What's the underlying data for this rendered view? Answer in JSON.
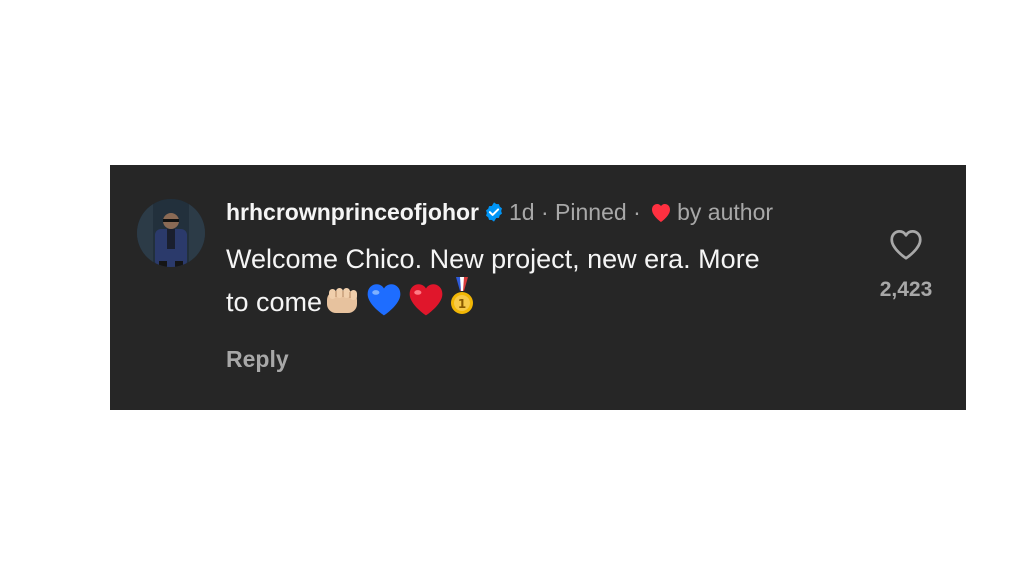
{
  "comment": {
    "username": "hrhcrownprinceofjohor",
    "verified": true,
    "time_ago": "1d",
    "separator": "·",
    "pinned_label": "Pinned",
    "liked_by_text": "by author",
    "text": "Welcome Chico. New project, new era. More to come",
    "emojis": [
      "fist-bump-emoji",
      "blue-heart-emoji",
      "red-heart-emoji",
      "gold-medal-emoji"
    ],
    "reply_label": "Reply",
    "like_count": "2,423"
  },
  "colors": {
    "card_background": "#262626",
    "primary_text": "#f5f5f5",
    "secondary_text": "#a8a8a8",
    "verified_blue": "#0095f6",
    "heart_red": "#ff3040"
  }
}
